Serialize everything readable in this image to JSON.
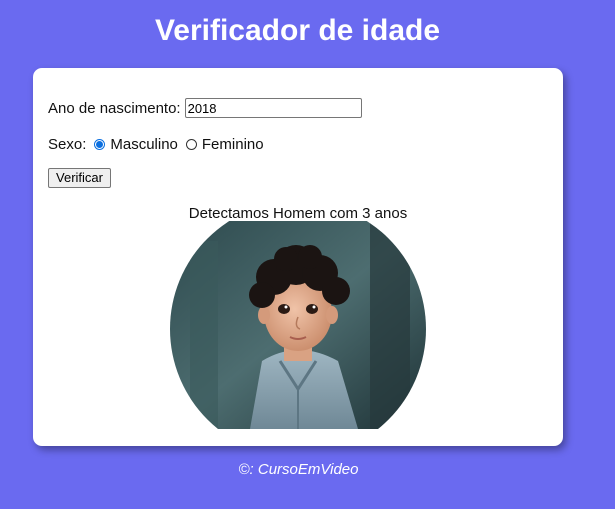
{
  "header": {
    "title": "Verificador de idade"
  },
  "form": {
    "year_label": "Ano de nascimento:",
    "year_value": "2018",
    "sex_label": "Sexo:",
    "sex_options": [
      {
        "label": "Masculino",
        "checked": true
      },
      {
        "label": "Feminino",
        "checked": false
      }
    ],
    "verify_label": "Verificar"
  },
  "result": {
    "text": "Detectamos Homem com 3 anos",
    "image": "photo of a young boy with curly dark hair in a blue striped shirt"
  },
  "footer": {
    "text": "©: CursoEmVideo"
  },
  "colors": {
    "background": "#6a6af0",
    "card": "#ffffff",
    "radio_accent": "#0b6fe0"
  }
}
